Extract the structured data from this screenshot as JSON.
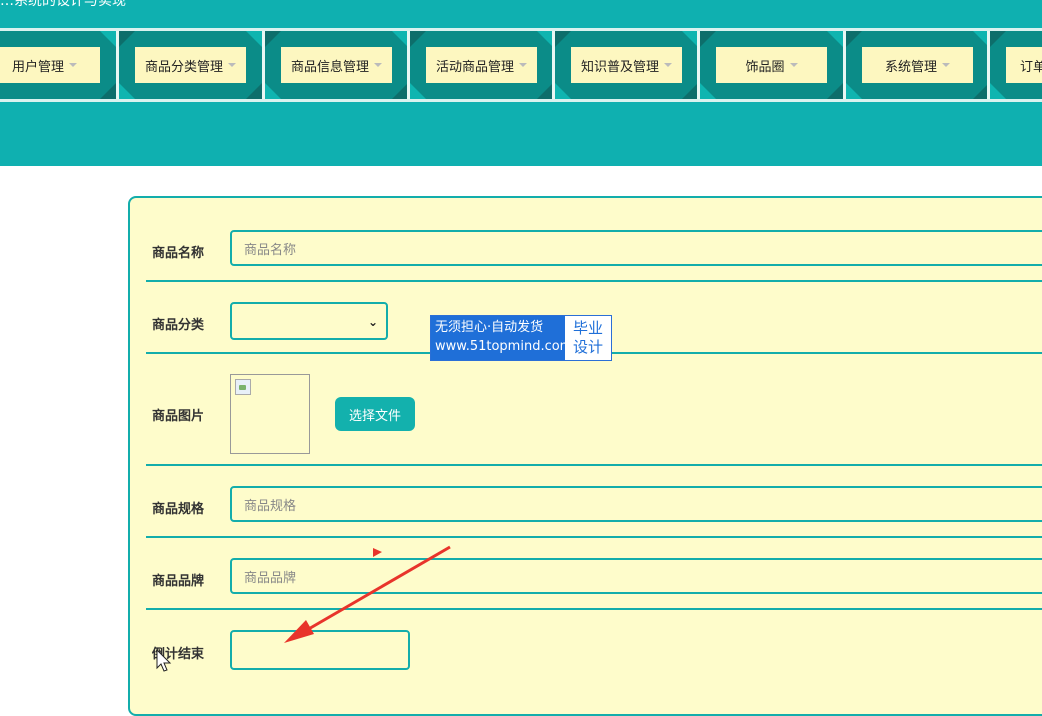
{
  "header": {
    "title": "…系统的设计与实现"
  },
  "nav": {
    "items": [
      {
        "label": "用户管理"
      },
      {
        "label": "商品分类管理"
      },
      {
        "label": "商品信息管理"
      },
      {
        "label": "活动商品管理"
      },
      {
        "label": "知识普及管理"
      },
      {
        "label": "饰品圈"
      },
      {
        "label": "系统管理"
      },
      {
        "label": "订单"
      }
    ]
  },
  "form": {
    "name": {
      "label": "商品名称",
      "placeholder": "商品名称"
    },
    "category": {
      "label": "商品分类",
      "value": ""
    },
    "image": {
      "label": "商品图片",
      "button": "选择文件"
    },
    "spec": {
      "label": "商品规格",
      "placeholder": "商品规格"
    },
    "brand": {
      "label": "商品品牌",
      "placeholder": "商品品牌"
    },
    "countdown": {
      "label": "倒计结束",
      "value": ""
    }
  },
  "watermark": {
    "line1": "无须担心·自动发货",
    "line2": "www.51topmind.com",
    "badge1": "毕业",
    "badge2": "设计"
  },
  "colors": {
    "teal": "#0fb0b0",
    "panel_bg": "#fefccb",
    "nav_face": "#fdf7c0",
    "annotation_arrow": "#e8342b"
  }
}
